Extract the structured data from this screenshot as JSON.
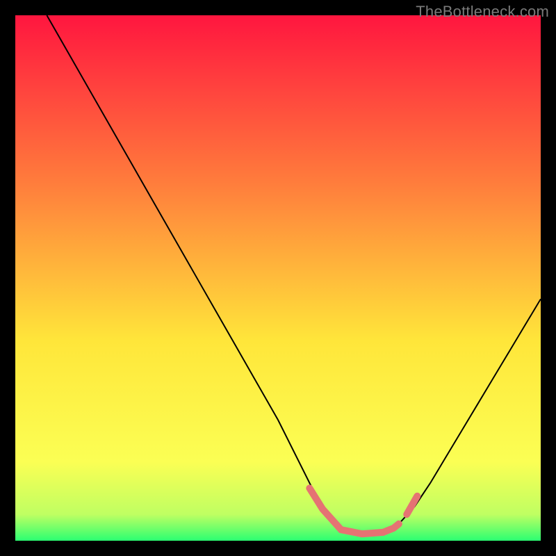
{
  "watermark": "TheBottleneck.com",
  "chart_data": {
    "type": "line",
    "title": "",
    "xlabel": "",
    "ylabel": "",
    "xlim": [
      0,
      100
    ],
    "ylim": [
      0,
      100
    ],
    "grid": false,
    "background_gradient": {
      "top_color": "#ff163f",
      "mid_color_1": "#ff7d3c",
      "mid_color_2": "#ffe63a",
      "lower_color": "#fbff54",
      "band_color": "#bfff62",
      "bottom_color": "#2bff72"
    },
    "series": [
      {
        "name": "bottleneck-curve",
        "color": "#000000",
        "x": [
          6,
          10,
          14,
          18,
          22,
          26,
          30,
          34,
          38,
          42,
          46,
          50,
          52,
          55,
          57,
          58,
          60,
          62,
          64,
          66,
          68,
          70,
          73,
          76,
          79,
          82,
          85,
          88,
          91,
          94,
          97,
          100
        ],
        "y": [
          100,
          93,
          86,
          79,
          72,
          65,
          58,
          51,
          44,
          37,
          30,
          23,
          19,
          13,
          9,
          7,
          4,
          2.5,
          1.5,
          1.3,
          1.3,
          1.7,
          3.2,
          6.5,
          11,
          16,
          21,
          26,
          31,
          36,
          41,
          46
        ]
      },
      {
        "name": "highlight-band",
        "color": "#e57373",
        "stroke_width": 10,
        "x": [
          56,
          58.5,
          62,
          66,
          70,
          72,
          73
        ],
        "y": [
          10,
          6,
          2.1,
          1.3,
          1.6,
          2.4,
          3.2
        ]
      },
      {
        "name": "highlight-tick-right",
        "color": "#e57373",
        "stroke_width": 10,
        "x": [
          74.5,
          76.5
        ],
        "y": [
          5.0,
          8.5
        ]
      }
    ]
  }
}
